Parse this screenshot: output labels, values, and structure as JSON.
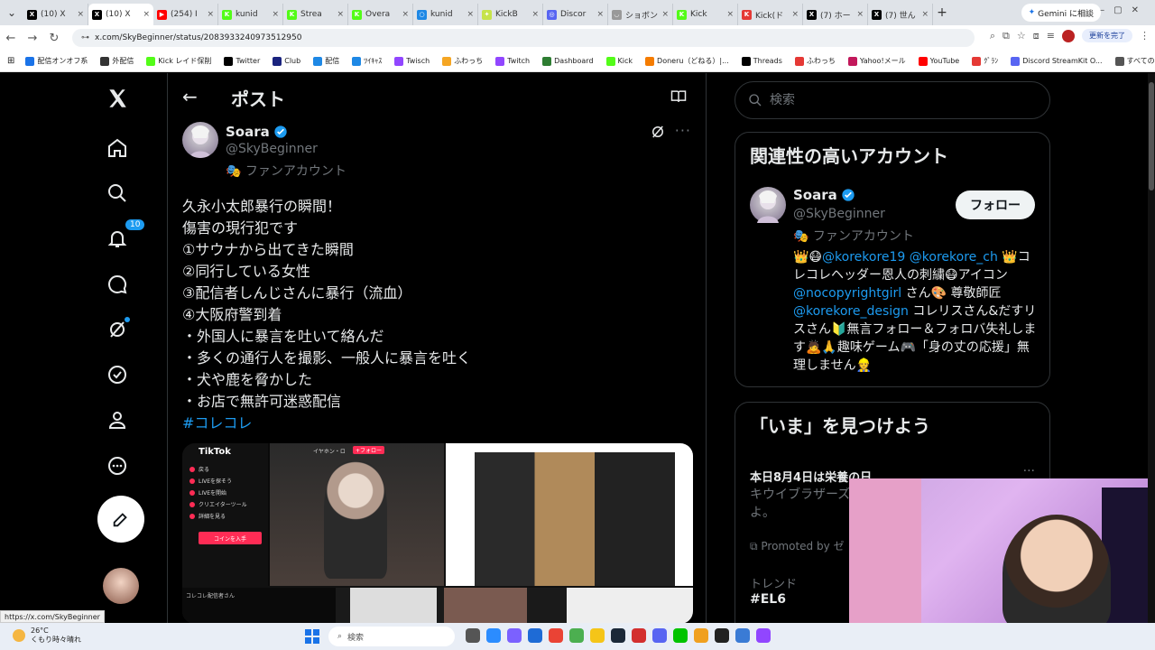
{
  "browser": {
    "tabs": [
      {
        "label": "(10) X",
        "color": "#000000",
        "glyph": "X",
        "active": false
      },
      {
        "label": "(10) X",
        "color": "#000000",
        "glyph": "X",
        "active": true
      },
      {
        "label": "(254) I",
        "color": "#ff0000",
        "glyph": "▶",
        "active": false
      },
      {
        "label": "kunid",
        "color": "#53fc18",
        "glyph": "K",
        "active": false
      },
      {
        "label": "Strea",
        "color": "#53fc18",
        "glyph": "K",
        "active": false
      },
      {
        "label": "Overa",
        "color": "#53fc18",
        "glyph": "K",
        "active": false
      },
      {
        "label": "kunid",
        "color": "#1e88e5",
        "glyph": "○",
        "active": false
      },
      {
        "label": "KickB",
        "color": "#c6e34a",
        "glyph": "✦",
        "active": false
      },
      {
        "label": "Discor",
        "color": "#5865f2",
        "glyph": "◎",
        "active": false
      },
      {
        "label": "ショボン",
        "color": "#999999",
        "glyph": "◡",
        "active": false
      },
      {
        "label": "Kick",
        "color": "#53fc18",
        "glyph": "K",
        "active": false
      },
      {
        "label": "Kick(ド",
        "color": "#e53935",
        "glyph": "K",
        "active": false
      },
      {
        "label": "(7) ホー",
        "color": "#000000",
        "glyph": "X",
        "active": false
      },
      {
        "label": "(7) 世ん",
        "color": "#000000",
        "glyph": "X",
        "active": false
      }
    ],
    "new_tab": "+",
    "gemini_label": "Gemini に相談",
    "url": "x.com/SkyBeginner/status/2083933240973512950",
    "update_label": "更新を完了",
    "bookmarks": [
      {
        "label": "配信オンオフ系",
        "color": "#1a73e8"
      },
      {
        "label": "外配信",
        "color": "#333333"
      },
      {
        "label": "Kick レイド保削",
        "color": "#53fc18"
      },
      {
        "label": "Twitter",
        "color": "#000000"
      },
      {
        "label": "Club",
        "color": "#1a237e"
      },
      {
        "label": "配信",
        "color": "#1e88e5"
      },
      {
        "label": "ﾂｲｷｬｽ",
        "color": "#1e88e5"
      },
      {
        "label": "Twisch",
        "color": "#9146ff"
      },
      {
        "label": "ふわっち",
        "color": "#f5a623"
      },
      {
        "label": "Twitch",
        "color": "#9146ff"
      },
      {
        "label": "Dashboard",
        "color": "#2e7d32"
      },
      {
        "label": "Kick",
        "color": "#53fc18"
      },
      {
        "label": "Doneru（どねる）|...",
        "color": "#f57c00"
      },
      {
        "label": "Threads",
        "color": "#000000"
      },
      {
        "label": "ふわっち",
        "color": "#e53935"
      },
      {
        "label": "Yahoo!メール",
        "color": "#c2185b"
      },
      {
        "label": "YouTube",
        "color": "#ff0000"
      },
      {
        "label": "ｸﾞﾗﾝ",
        "color": "#e53935"
      },
      {
        "label": "Discord StreamKit O...",
        "color": "#5865f2"
      },
      {
        "label": "すべてのブックマーク",
        "color": "#555555"
      }
    ],
    "status_url": "https://x.com/SkyBeginner"
  },
  "nav": {
    "notification_count": "10"
  },
  "main": {
    "title": "ポスト",
    "author": {
      "name": "Soara",
      "handle": "@SkyBeginner",
      "affiliation": "🎭 ファンアカウント"
    },
    "post_lines": [
      "久永小太郎暴行の瞬間！",
      "傷害の現行犯です",
      "①サウナから出てきた瞬間",
      "②同行している女性",
      "③配信者しんじさんに暴行（流血）",
      "④大阪府警到着",
      "・外国人に暴言を吐いて絡んだ",
      "・多くの通行人を撮影、一般人に暴言を吐く",
      "・犬や鹿を脅かした",
      "・お店で無許可迷惑配信"
    ],
    "hashtag": "#コレコレ",
    "media": {
      "tiktok_label": "TikTok",
      "menu": [
        "戻る",
        "LIVEを探そう",
        "LIVEを開始",
        "クリエイターツール",
        "詳細を見る"
      ],
      "coin_button": "コインを入手",
      "follow_label": "+フォロー"
    }
  },
  "right": {
    "search_placeholder": "検索",
    "related_title": "関連性の高いアカウント",
    "related": {
      "name": "Soara",
      "handle": "@SkyBeginner",
      "affiliation": "🎭 ファンアカウント",
      "follow_label": "フォロー",
      "bio_parts": [
        {
          "t": "👑😷",
          "m": false
        },
        {
          "t": "@korekore19",
          "m": true
        },
        {
          "t": " ",
          "m": false
        },
        {
          "t": "@korekore_ch",
          "m": true
        },
        {
          "t": " 👑コレコレヘッダー恩人の刺繍😷アイコン",
          "m": false
        },
        {
          "t": "@nocopyrightgirl",
          "m": true
        },
        {
          "t": " さん🎨 尊敬師匠 ",
          "m": false
        },
        {
          "t": "@korekore_design",
          "m": true
        },
        {
          "t": " コレリスさん&だすリスさん🔰無言フォロー＆フォロバ失礼します🙇🙏趣味ゲーム🎮「身の丈の応援」無理しません👷",
          "m": false
        }
      ]
    },
    "trends_title": "「いま」を見つけよう",
    "trend": {
      "headline": "本日8月4日は栄養の日",
      "desc": "キウイブラザーズ... る！栄養不良が多... あるよ。",
      "promoted": "Promoted by ゼ",
      "label": "トレンド",
      "tag": "#EL6"
    }
  },
  "taskbar": {
    "temp": "26°C",
    "weather": "くもり時々晴れ",
    "search": "検索",
    "apps": [
      "#555555",
      "#2b8cff",
      "#7b61ff",
      "#1e6bd6",
      "#ea4335",
      "#4caf50",
      "#f5c518",
      "#1b2838",
      "#d32f2f",
      "#5865f2",
      "#00c300",
      "#f0a020",
      "#222222",
      "#3a7bd5",
      "#9146ff"
    ]
  },
  "colors": {
    "accent": "#1d9bf0",
    "background": "#000000",
    "border": "#2f3336",
    "muted": "#71767b"
  }
}
